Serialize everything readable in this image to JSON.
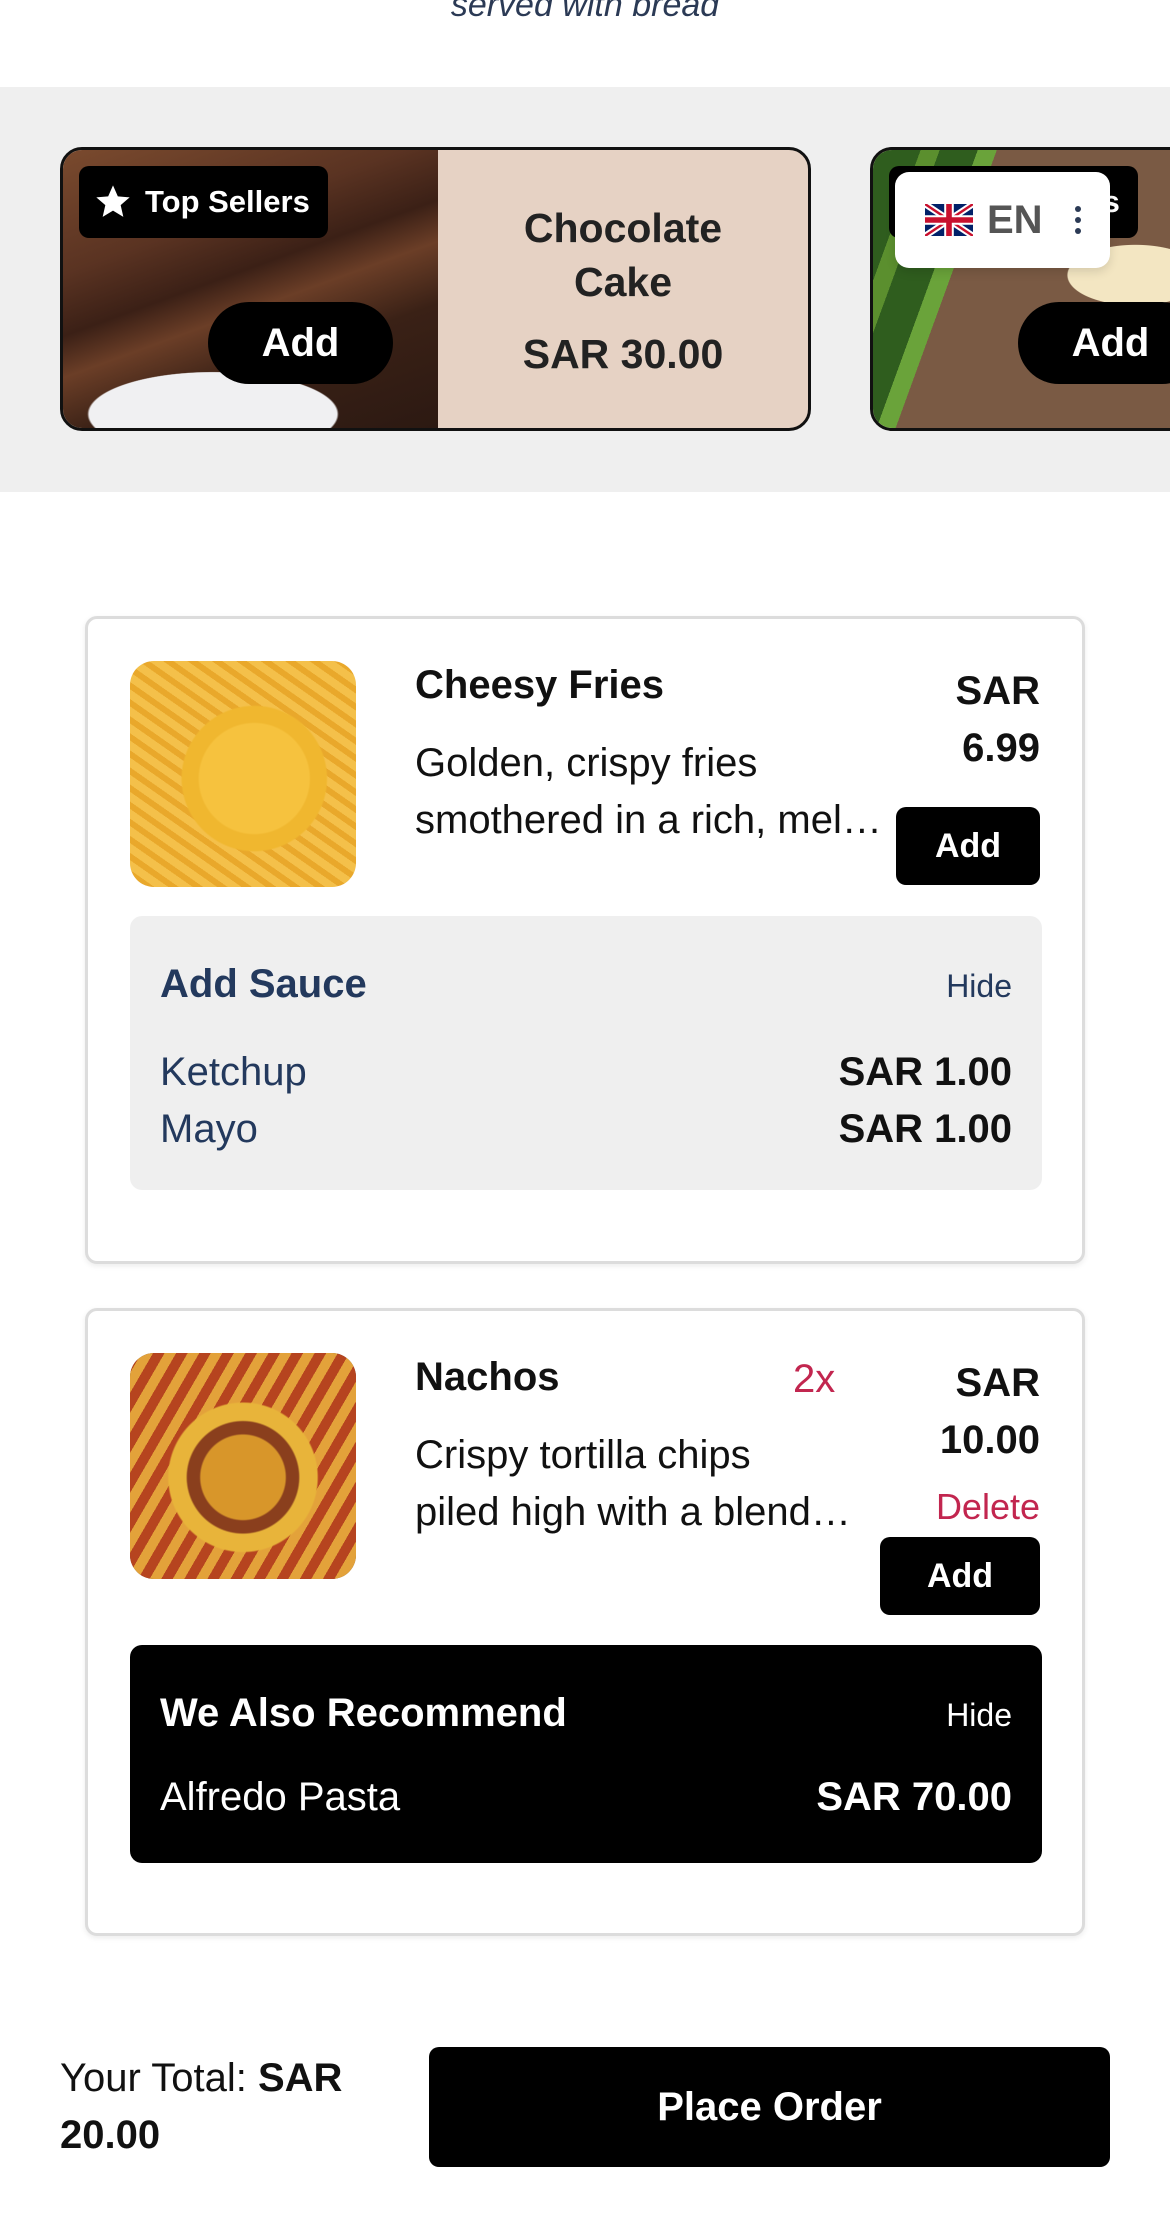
{
  "top_text": "served with bread",
  "language": {
    "label": "EN",
    "flag_icon": "uk-flag-icon"
  },
  "top_sellers": {
    "badge_label": "Top Sellers",
    "items": [
      {
        "name_line1": "Chocolate",
        "name_line2": "Cake",
        "price": "SAR 30.00",
        "add_label": "Add"
      },
      {
        "add_label": "Add"
      }
    ]
  },
  "items": [
    {
      "name": "Cheesy Fries",
      "desc_line1": "Golden, crispy fries",
      "desc_line2": "smothered in a rich, melted cheese sauce",
      "price_line1": "SAR",
      "price_line2": "6.99",
      "add_label": "Add",
      "addon": {
        "title": "Add Sauce",
        "hide_label": "Hide",
        "options": [
          {
            "name": "Ketchup",
            "price": "SAR 1.00"
          },
          {
            "name": "Mayo",
            "price": "SAR 1.00"
          }
        ]
      }
    },
    {
      "name": "Nachos",
      "quantity": "2x",
      "desc_line1": "Crispy tortilla chips",
      "desc_line2": "piled high with a blend of cheeses",
      "price_line1": "SAR",
      "price_line2": "10.00",
      "delete_label": "Delete",
      "add_label": "Add",
      "recommend": {
        "title": "We Also Recommend",
        "hide_label": "Hide",
        "item": {
          "name": "Alfredo Pasta",
          "price": "SAR 70.00"
        }
      }
    }
  ],
  "footer": {
    "total_label": "Your Total:",
    "total_line1": "SAR",
    "total_line2": "20.00",
    "place_order_label": "Place Order"
  },
  "colors": {
    "accent": "#000000",
    "navy": "#23395d",
    "danger": "#c2264f",
    "card_bg": "#e6d2c4"
  }
}
